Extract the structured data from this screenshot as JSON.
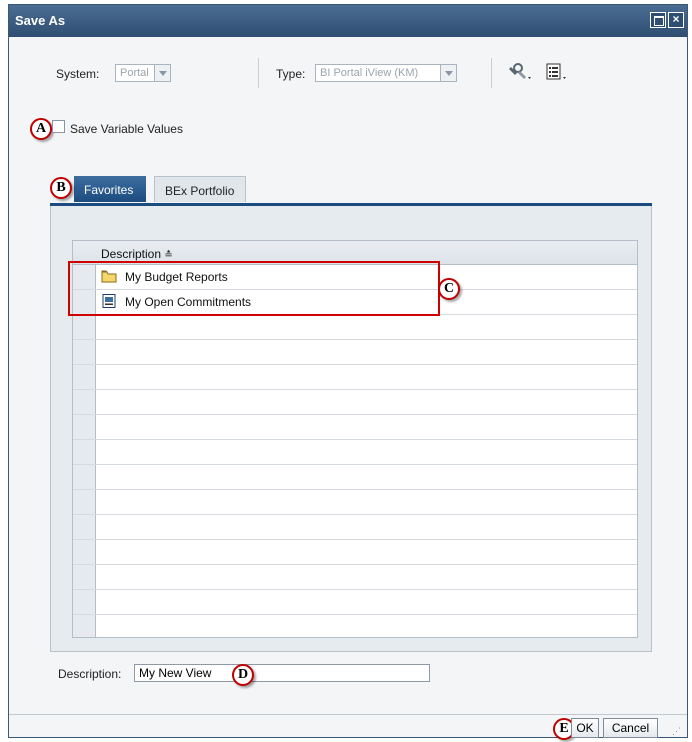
{
  "window": {
    "title": "Save As"
  },
  "toolbar": {
    "system_label": "System:",
    "system_value": "Portal",
    "type_label": "Type:",
    "type_value": "BI Portal iView (KM)",
    "tools_icon": "wrench-key-icon",
    "list_icon": "list-view-icon"
  },
  "save_variables": {
    "label": "Save Variable Values",
    "checked": false
  },
  "tabs": [
    {
      "label": "Favorites",
      "active": true
    },
    {
      "label": "BEx Portfolio",
      "active": false
    }
  ],
  "table": {
    "column_header": "Description",
    "sort_indicator": "≛",
    "rows": [
      {
        "icon": "folder-icon",
        "label": "My Budget Reports"
      },
      {
        "icon": "report-document-icon",
        "label": "My Open Commitments"
      }
    ],
    "empty_rows": 13
  },
  "description_field": {
    "label": "Description:",
    "value": "My New View"
  },
  "buttons": {
    "ok": "OK",
    "cancel": "Cancel"
  },
  "callouts": {
    "a": "A",
    "b": "B",
    "c": "C",
    "d": "D",
    "e": "E"
  },
  "colors": {
    "accent": "#1c4b80",
    "titlebar": "#2e4e72",
    "callout_border": "#c00000",
    "highlight": "#d00000"
  }
}
